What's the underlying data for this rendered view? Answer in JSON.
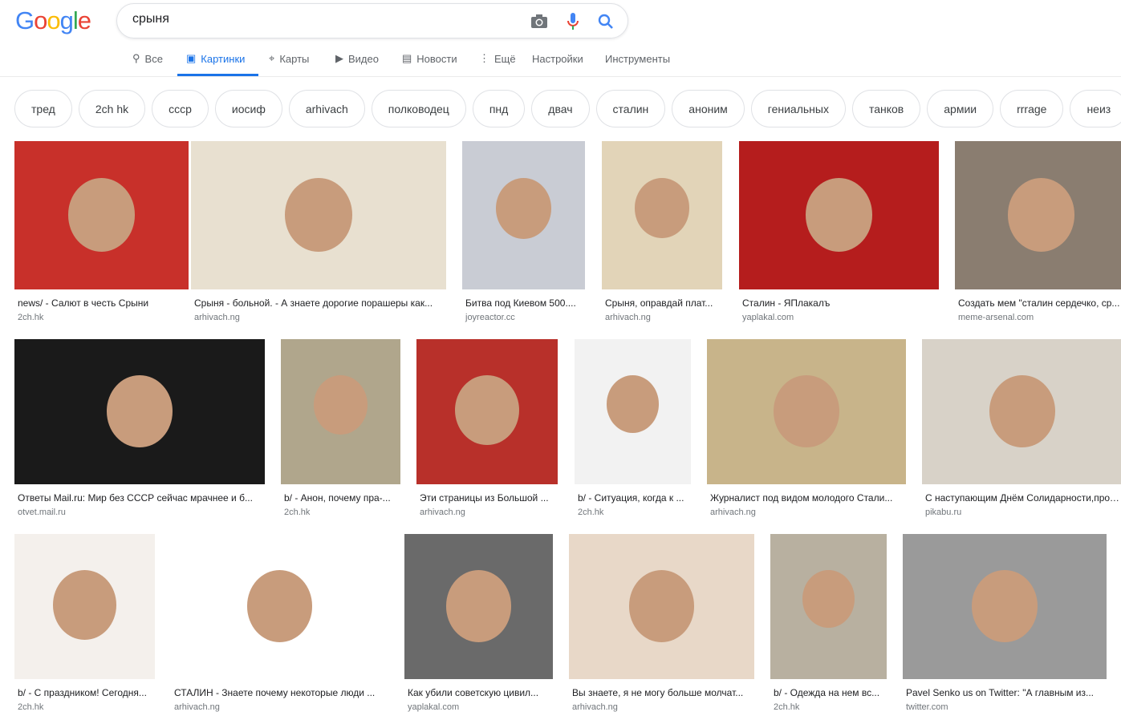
{
  "logo": "Google",
  "search": {
    "value": "срыня"
  },
  "tabs": [
    {
      "label": "Все",
      "icon": "search-icon"
    },
    {
      "label": "Картинки",
      "icon": "image-icon",
      "active": true
    },
    {
      "label": "Карты",
      "icon": "map-pin-icon"
    },
    {
      "label": "Видео",
      "icon": "play-icon"
    },
    {
      "label": "Новости",
      "icon": "news-icon"
    },
    {
      "label": "Ещё",
      "icon": "more-icon"
    },
    {
      "label": "Настройки"
    },
    {
      "label": "Инструменты"
    }
  ],
  "chips": [
    "тред",
    "2ch hk",
    "ссср",
    "иосиф",
    "arhivach",
    "полководец",
    "пнд",
    "двач",
    "сталин",
    "аноним",
    "гениальных",
    "танков",
    "армии",
    "rrrage",
    "неиз"
  ],
  "results": [
    {
      "caption": "news/ - Салют в честь Срыни",
      "source": "2ch.hk",
      "color": "#c8302a"
    },
    {
      "caption": "Срыня - больной. - А знаете дорогие порашеры как...",
      "source": "arhivach.ng",
      "color": "#e8e0d0"
    },
    {
      "caption": "Битва под Киевом 500....",
      "source": "joyreactor.cc",
      "color": "#c9ccd4"
    },
    {
      "caption": "Срыня, оправдай плат...",
      "source": "arhivach.ng",
      "color": "#e2d4b8"
    },
    {
      "caption": "Сталин - ЯПлакалъ",
      "source": "yaplakal.com",
      "color": "#b51d1d"
    },
    {
      "caption": "Создать мем \"сталин сердечко, ср...",
      "source": "meme-arsenal.com",
      "color": "#8a7d70"
    },
    {
      "caption": "Ответы Mail.ru: Мир без СССР сейчас мрачнее и б...",
      "source": "otvet.mail.ru",
      "color": "#1a1a1a"
    },
    {
      "caption": "b/ - Анон, почему пра-...",
      "source": "2ch.hk",
      "color": "#b0a68c"
    },
    {
      "caption": "Эти страницы из Большой ...",
      "source": "arhivach.ng",
      "color": "#b8302a"
    },
    {
      "caption": "b/ - Ситуация, когда к ...",
      "source": "2ch.hk",
      "color": "#f2f2f2"
    },
    {
      "caption": "Журналист под видом молодого Стали...",
      "source": "arhivach.ng",
      "color": "#c8b48a"
    },
    {
      "caption": "С наступающим Днём Солидарности,прол...",
      "source": "pikabu.ru",
      "color": "#d8d2c8"
    },
    {
      "caption": "b/ - С праздником! Сегодня...",
      "source": "2ch.hk",
      "color": "#f4f0ec"
    },
    {
      "caption": "СТАЛИН - Знаете почему некоторые люди ...",
      "source": "arhivach.ng",
      "color": "#ffffff"
    },
    {
      "caption": "Как убили советскую цивил...",
      "source": "yaplakal.com",
      "color": "#6a6a6a"
    },
    {
      "caption": "Вы знаете, я не могу больше молчат...",
      "source": "arhivach.ng",
      "color": "#e8d8c8"
    },
    {
      "caption": "b/ - Одежда на нем вс...",
      "source": "2ch.hk",
      "color": "#b8b0a0"
    },
    {
      "caption": "Pavel Senko us on Twitter: \"А главным из...",
      "source": "twitter.com",
      "color": "#9a9a9a"
    }
  ]
}
